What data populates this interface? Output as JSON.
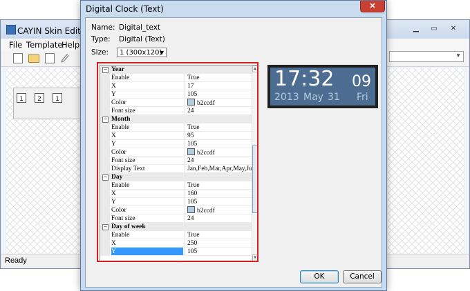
{
  "background_app": {
    "title": "CAYIN Skin Editor - 未",
    "menu": [
      "File",
      "Template",
      "Help"
    ],
    "status": "Ready",
    "page_tabs": [
      "1",
      "2",
      "1"
    ]
  },
  "dialog": {
    "title": "Digital Clock (Text)",
    "close_glyph": "✕",
    "name_label": "Name:",
    "name_value": "Digital_text",
    "type_label": "Type:",
    "type_value": "Digital (Text)",
    "size_label": "Size:",
    "size_value": "1  (300x120)",
    "ok_label": "OK",
    "cancel_label": "Cancel"
  },
  "properties": {
    "year": {
      "label": "Year",
      "enable_name": "Enable",
      "enable_value": "True",
      "x_name": "X",
      "x_value": "17",
      "y_name": "Y",
      "y_value": "105",
      "color_name": "Color",
      "color_value": "b2ccdf",
      "fontsize_name": "Font size",
      "fontsize_value": "24"
    },
    "month": {
      "label": "Month",
      "enable_name": "Enable",
      "enable_value": "True",
      "x_name": "X",
      "x_value": "95",
      "y_name": "Y",
      "y_value": "105",
      "color_name": "Color",
      "color_value": "b2ccdf",
      "fontsize_name": "Font size",
      "fontsize_value": "24",
      "display_name": "Display Text",
      "display_value": "Jan,Feb,Mar,Apr,May,Ju..."
    },
    "day": {
      "label": "Day",
      "enable_name": "Enable",
      "enable_value": "True",
      "x_name": "X",
      "x_value": "160",
      "y_name": "Y",
      "y_value": "105",
      "color_name": "Color",
      "color_value": "b2ccdf",
      "fontsize_name": "Font size",
      "fontsize_value": "24"
    },
    "dow": {
      "label": "Day of week",
      "enable_name": "Enable",
      "enable_value": "True",
      "x_name": "X",
      "x_value": "250",
      "y_name": "Y",
      "y_value": "105"
    }
  },
  "preview": {
    "time": "17:32",
    "seconds": "09",
    "year": "2013",
    "month": "May",
    "day": "31",
    "weekday": "Fri"
  },
  "colors": {
    "swatch": "#b2ccdf",
    "selection": "#3399ff",
    "highlight": "#d61f1f",
    "clock_bg": "#4c6d91"
  },
  "icons": [
    "new-document-icon",
    "open-folder-icon",
    "save-icon",
    "pencil-icon",
    "minimize-icon",
    "restore-icon",
    "close-icon",
    "collapse-icon"
  ]
}
